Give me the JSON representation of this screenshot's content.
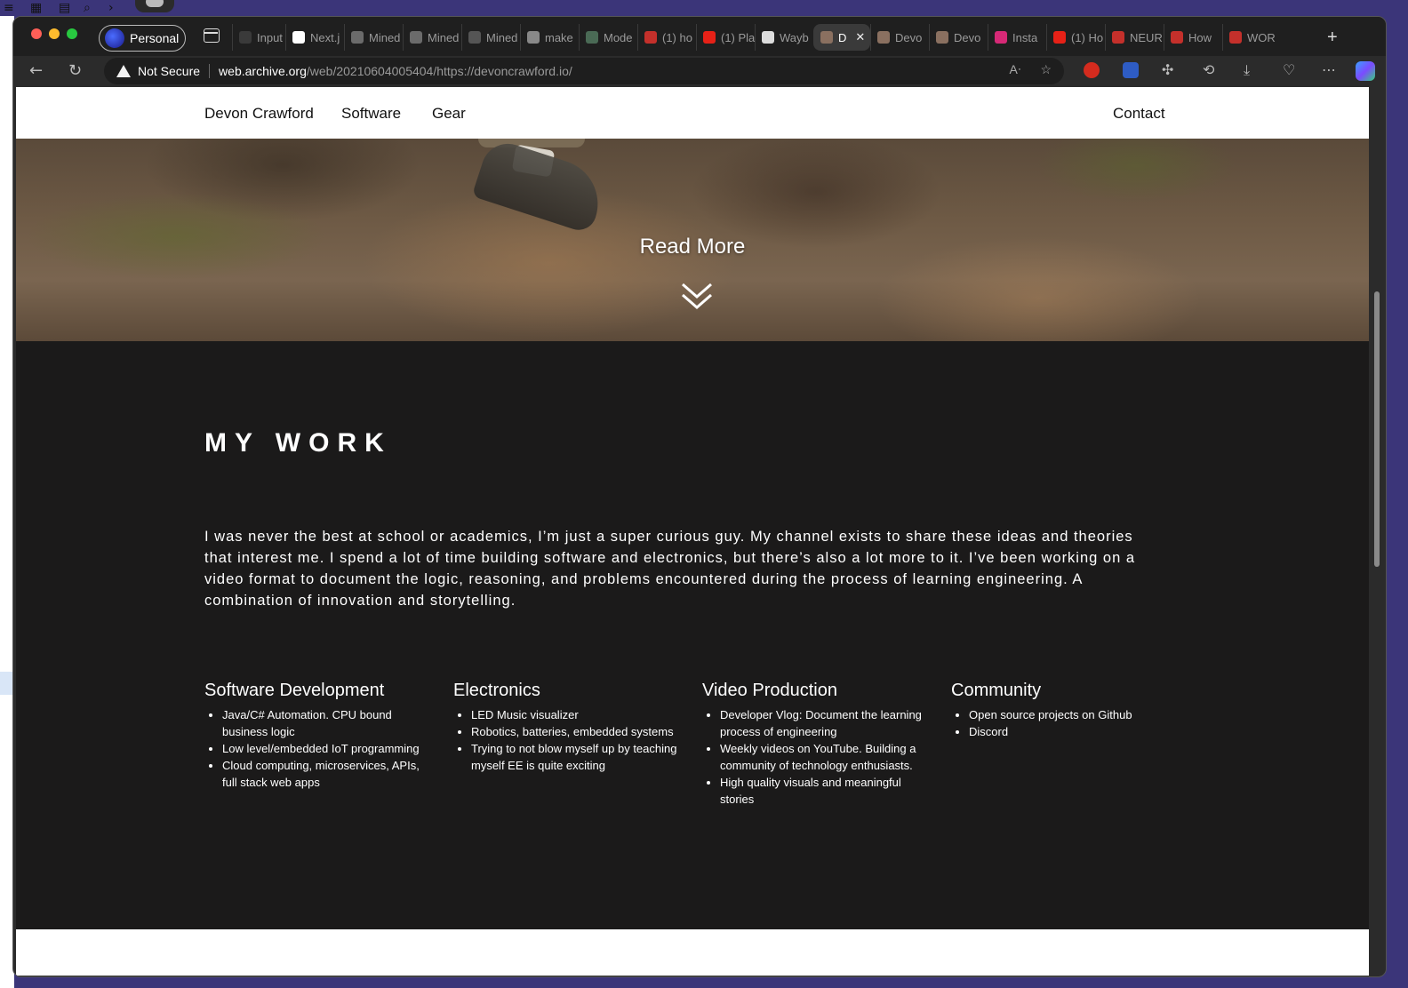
{
  "browser": {
    "profile_label": "Personal",
    "tabs": [
      {
        "title": "Input",
        "favicon_color": "#3a3a3a"
      },
      {
        "title": "Next.j",
        "favicon_color": "#ffffff"
      },
      {
        "title": "Mined",
        "favicon_color": "#6b6b6b"
      },
      {
        "title": "Mined",
        "favicon_color": "#6b6b6b"
      },
      {
        "title": "Mined",
        "favicon_color": "#555555"
      },
      {
        "title": "make",
        "favicon_color": "#888888"
      },
      {
        "title": "Mode",
        "favicon_color": "#4a6a55"
      },
      {
        "title": "(1) ho",
        "favicon_color": "#c4302b"
      },
      {
        "title": "(1) Pla",
        "favicon_color": "#e62117"
      },
      {
        "title": "Wayb",
        "favicon_color": "#dddddd"
      },
      {
        "title": "D",
        "favicon_color": "#8a7060",
        "active": true
      },
      {
        "title": "Devo",
        "favicon_color": "#8a7060"
      },
      {
        "title": "Devo",
        "favicon_color": "#8a7060"
      },
      {
        "title": "Insta",
        "favicon_color": "#d62976"
      },
      {
        "title": "(1) Ho",
        "favicon_color": "#e62117"
      },
      {
        "title": "NEUR",
        "favicon_color": "#c4302b"
      },
      {
        "title": "How",
        "favicon_color": "#c4302b"
      },
      {
        "title": "WOR",
        "favicon_color": "#c4302b"
      }
    ],
    "security_label": "Not Secure",
    "url_host": "web.archive.org",
    "url_path": "/web/20210604005404/https://devoncrawford.io/"
  },
  "site": {
    "nav": {
      "home": "Devon Crawford",
      "software": "Software",
      "gear": "Gear",
      "contact": "Contact"
    },
    "hero": {
      "read_more": "Read More"
    },
    "my_work": {
      "heading": "MY WORK",
      "intro": "I was never the best at school or academics, I’m just a super curious guy. My channel exists to share these ideas and theories that interest me. I spend a lot of time building software and electronics, but there’s also a lot more to it. I’ve been working on a video format to document the logic, reasoning, and problems encountered during the process of learning engineering. A combination of innovation and storytelling.",
      "columns": [
        {
          "title": "Software Development",
          "items": [
            "Java/C# Automation. CPU bound business logic",
            "Low level/embedded IoT programming",
            "Cloud computing, microservices, APIs, full stack web apps"
          ]
        },
        {
          "title": "Electronics",
          "items": [
            "LED Music visualizer",
            "Robotics, batteries, embedded systems",
            "Trying to not blow myself up by teaching myself EE is quite exciting"
          ]
        },
        {
          "title": "Video Production",
          "items": [
            "Developer Vlog: Document the learning process of engineering",
            "Weekly videos on YouTube. Building a community of technology enthusiasts.",
            "High quality visuals and meaningful stories"
          ]
        },
        {
          "title": "Community",
          "items": [
            "Open source projects on Github",
            "Discord"
          ]
        }
      ]
    }
  }
}
